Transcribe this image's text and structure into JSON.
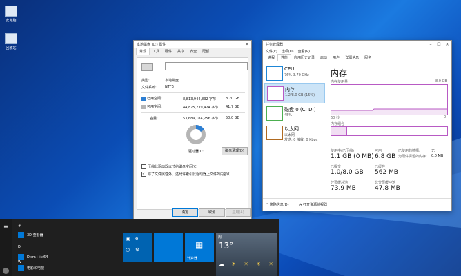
{
  "desktop": {
    "icons": [
      {
        "label": "此电脑"
      },
      {
        "label": "回收站"
      }
    ]
  },
  "properties": {
    "title": "本地磁盘 (C:) 属性",
    "tabs": [
      "常规",
      "工具",
      "硬件",
      "共享",
      "安全",
      "配额"
    ],
    "type_label": "类型:",
    "type_value": "本地磁盘",
    "fs_label": "文件系统:",
    "fs_value": "NTFS",
    "used_label": "已用空间:",
    "used_bytes": "8,813,944,832 字节",
    "used_gb": "8.20 GB",
    "free_label": "可用空间:",
    "free_bytes": "44,875,239,424 字节",
    "free_gb": "41.7 GB",
    "cap_label": "容量:",
    "cap_bytes": "53,689,184,256 字节",
    "cap_gb": "50.0 GB",
    "drive_label": "驱动器 C:",
    "cleanup_button": "磁盘清理(D)",
    "compress_label": "压缩此驱动器以节约磁盘空间(C)",
    "index_label": "除了文件属性外，还允许索引此驱动器上文件的内容(I)",
    "ok": "确定",
    "cancel": "取消",
    "apply": "应用(A)",
    "used_fraction": 0.164,
    "colors": {
      "used": "#2d7fd3",
      "free": "#b5b5b5"
    }
  },
  "taskmgr": {
    "title": "任务管理器",
    "menu": [
      "文件(F)",
      "选项(O)",
      "查看(V)"
    ],
    "tabs": [
      "进程",
      "性能",
      "应用历史记录",
      "启动",
      "用户",
      "详细信息",
      "服务"
    ],
    "side": [
      {
        "name": "CPU",
        "sub": "76% 3.70 GHz"
      },
      {
        "name": "内存",
        "sub": "1.2/8.0 GB (15%)"
      },
      {
        "name": "磁盘 0 (C: D:)",
        "sub": "45%"
      },
      {
        "name": "以太网",
        "sub": "以太网",
        "sub2": "发送: 0 接收: 0 Kbps"
      }
    ],
    "main_title": "内存",
    "usage_label": "内存使用量",
    "usage_max": "8.0 GB",
    "sec_label": "60 秒",
    "sec_right": "0",
    "comp_label": "内存组合",
    "stats": [
      {
        "label": "使用中(已压缩)",
        "value": "1.1 GB (0 MB)"
      },
      {
        "label": "可用",
        "value": "6.8 GB"
      },
      {
        "label": "已提交",
        "value": "1.0/8.0 GB"
      },
      {
        "label": "已缓存",
        "value": "562 MB"
      },
      {
        "label": "分页缓冲池",
        "value": "73.9 MB"
      },
      {
        "label": "非分页缓冲池",
        "value": "47.8 MB"
      }
    ],
    "side_stats": [
      {
        "label": "已使用的插槽:",
        "value": "无"
      },
      {
        "label": "为硬件保留的内存:",
        "value": "0.0 MB"
      }
    ],
    "fewer_details": "简略信息(D)",
    "open_monitor": "打开资源监视器",
    "colors": {
      "mem": "#b85ac4",
      "cpu": "#1e86d6",
      "disk": "#4caf50",
      "net": "#b06a20"
    }
  },
  "start": {
    "letters": [
      "#",
      "D",
      "W"
    ],
    "apps": [
      "3D 查看器",
      "Dism++x64",
      "电影和电视"
    ],
    "calc": "计算器",
    "weather_day": "周",
    "temp": "13°"
  }
}
